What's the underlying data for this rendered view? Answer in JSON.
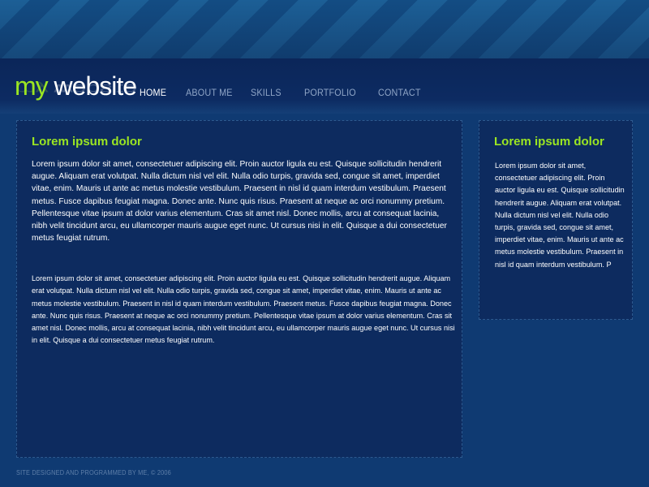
{
  "logo": {
    "part1": "my",
    "part2": " website"
  },
  "nav": [
    {
      "label": "HOME",
      "active": true
    },
    {
      "label": "ABOUT ME",
      "active": false
    },
    {
      "label": "SKILLS",
      "active": false
    },
    {
      "label": "PORTFOLIO",
      "active": false
    },
    {
      "label": "CONTACT",
      "active": false
    }
  ],
  "main": {
    "title": "Lorem ipsum dolor",
    "paragraph1": "Lorem ipsum dolor sit amet, consectetuer adipiscing elit. Proin auctor ligula eu est. Quisque sollicitudin hendrerit augue. Aliquam erat volutpat. Nulla dictum nisl vel elit. Nulla odio turpis, gravida sed, congue sit amet, imperdiet vitae, enim. Mauris ut ante ac metus molestie vestibulum. Praesent in nisl id quam interdum vestibulum. Praesent metus. Fusce dapibus feugiat magna. Donec ante. Nunc quis risus. Praesent at neque ac orci nonummy pretium. Pellentesque vitae ipsum at dolor varius elementum. Cras sit amet nisl. Donec mollis, arcu at consequat lacinia, nibh velit tincidunt arcu, eu ullamcorper mauris augue eget nunc. Ut cursus nisi in elit. Quisque a dui consectetuer metus feugiat rutrum.",
    "paragraph2": "Lorem ipsum dolor sit amet, consectetuer adipiscing elit. Proin auctor ligula eu est. Quisque sollicitudin hendrerit augue. Aliquam erat volutpat. Nulla dictum nisl vel elit. Nulla odio turpis, gravida sed, congue sit amet, imperdiet vitae, enim. Mauris ut ante ac metus molestie vestibulum. Praesent in nisl id quam interdum vestibulum. Praesent metus. Fusce dapibus feugiat magna. Donec ante. Nunc quis risus. Praesent at neque ac orci nonummy pretium. Pellentesque vitae ipsum at dolor varius elementum. Cras sit amet nisl. Donec mollis, arcu at consequat lacinia, nibh velit tincidunt arcu, eu ullamcorper mauris augue eget nunc. Ut cursus nisi in elit. Quisque a dui consectetuer metus feugiat rutrum."
  },
  "side": {
    "title": "Lorem ipsum dolor",
    "paragraph": "Lorem ipsum dolor sit amet, consectetuer adipiscing elit. Proin auctor ligula eu est. Quisque sollicitudin hendrerit augue. Aliquam erat volutpat. Nulla dictum nisl vel elit. Nulla odio turpis, gravida sed, congue sit amet, imperdiet vitae, enim. Mauris ut ante ac metus molestie vestibulum. Praesent in nisl id quam interdum vestibulum. P"
  },
  "footer": {
    "text": "SITE DESIGNED AND PROGRAMMED BY ME, © 2006"
  },
  "colors": {
    "accent_green": "#9be622",
    "background": "#0f3a72",
    "panel": "#0d2b5f",
    "nav_inactive": "#8fa5c6",
    "nav_active": "#ffffff"
  }
}
